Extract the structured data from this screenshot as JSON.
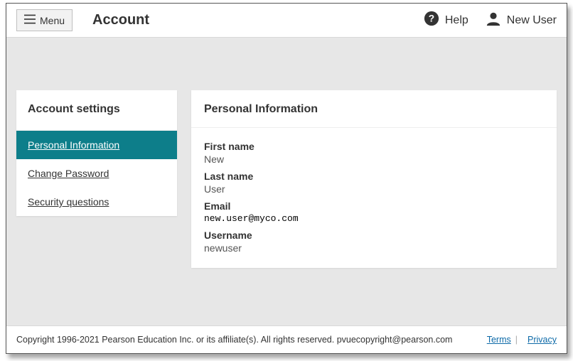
{
  "header": {
    "menu_label": "Menu",
    "page_title": "Account",
    "help_label": "Help",
    "user_label": "New User"
  },
  "sidebar": {
    "title": "Account settings",
    "items": [
      {
        "label": "Personal Information",
        "active": true
      },
      {
        "label": "Change Password",
        "active": false
      },
      {
        "label": "Security questions",
        "active": false
      }
    ]
  },
  "panel": {
    "title": "Personal Information",
    "fields": {
      "first_name": {
        "label": "First name",
        "value": "New"
      },
      "last_name": {
        "label": "Last name",
        "value": "User"
      },
      "email": {
        "label": "Email",
        "value": "new.user@myco.com"
      },
      "username": {
        "label": "Username",
        "value": "newuser"
      }
    }
  },
  "footer": {
    "copyright": "Copyright 1996-2021 Pearson Education Inc. or its affiliate(s). All rights reserved. pvuecopyright@pearson.com",
    "terms_label": "Terms ",
    "privacy_label": "Privacy"
  }
}
